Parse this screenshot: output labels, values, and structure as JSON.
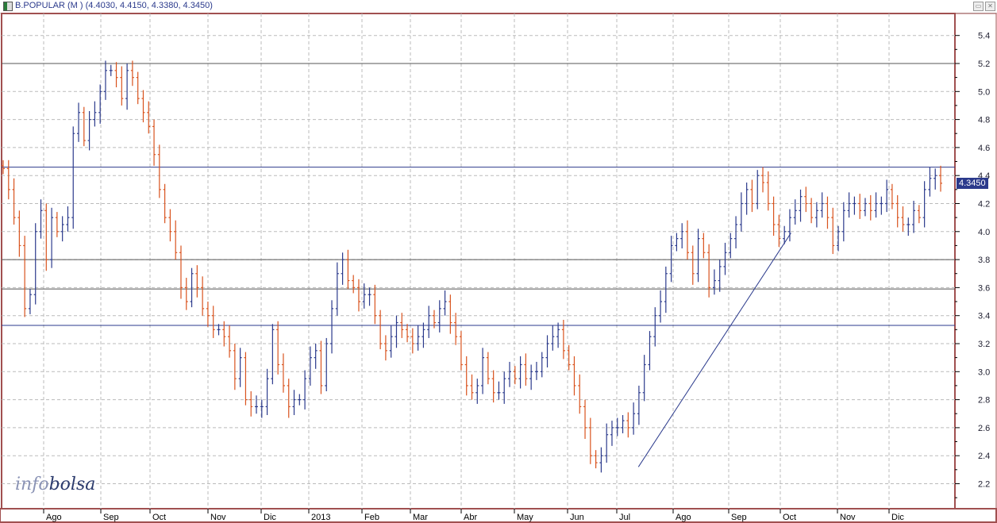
{
  "window": {
    "title": "B.POPULAR (M ) (4.4030, 4.4150, 4.3380, 4.3450)",
    "icon": "chart-window-icon",
    "buttons": [
      "maximize-icon",
      "close-icon"
    ]
  },
  "logo": {
    "part1": "info",
    "part2": "bolsa"
  },
  "last_price_tag": "4.3450",
  "colors": {
    "up": "#2b3a8c",
    "down": "#d9531e",
    "border": "#a05050",
    "grid": "#bbbbbb"
  },
  "chart_data": {
    "type": "ohlc",
    "ylim": [
      2.0,
      5.5
    ],
    "yticks": [
      "5.4",
      "5.2",
      "5.0",
      "4.8",
      "4.6",
      "4.4",
      "4.2",
      "4.0",
      "3.8",
      "3.6",
      "3.4",
      "3.2",
      "3.0",
      "2.8",
      "2.6",
      "2.4",
      "2.2"
    ],
    "xticks": [
      "Ago",
      "Sep",
      "Oct",
      "Nov",
      "Dic",
      "2013",
      "Feb",
      "Mar",
      "Abr",
      "May",
      "Jun",
      "Jul",
      "Ago",
      "Sep",
      "Oct",
      "Nov",
      "Dic"
    ],
    "grid": true,
    "horizontal_lines": [
      {
        "value": 5.2,
        "color": "#555555"
      },
      {
        "value": 4.46,
        "color": "#2b3a8c"
      },
      {
        "value": 3.8,
        "color": "#555555"
      },
      {
        "value": 3.59,
        "color": "#555555"
      },
      {
        "value": 3.33,
        "color": "#2b3a8c"
      }
    ],
    "trendline": {
      "from": {
        "bar_fraction": 0.668,
        "value": 2.32
      },
      "to": {
        "bar_fraction": 0.828,
        "value": 3.99
      },
      "color": "#2b3a8c"
    },
    "closes": [
      4.45,
      4.3,
      4.1,
      3.9,
      3.45,
      3.55,
      4.0,
      4.15,
      3.8,
      4.1,
      4.0,
      4.05,
      4.1,
      4.7,
      4.85,
      4.65,
      4.8,
      4.85,
      5.0,
      5.15,
      5.15,
      5.1,
      4.95,
      5.15,
      5.1,
      4.95,
      4.85,
      4.75,
      4.55,
      4.3,
      4.1,
      4.0,
      3.85,
      3.6,
      3.5,
      3.7,
      3.6,
      3.45,
      3.4,
      3.3,
      3.3,
      3.25,
      3.15,
      2.95,
      3.1,
      2.8,
      2.75,
      2.75,
      2.75,
      2.95,
      3.3,
      3.05,
      2.9,
      2.75,
      2.8,
      2.8,
      2.95,
      3.1,
      3.15,
      2.9,
      3.2,
      3.45,
      3.7,
      3.8,
      3.65,
      3.6,
      3.5,
      3.55,
      3.55,
      3.4,
      3.2,
      3.15,
      3.25,
      3.35,
      3.3,
      3.25,
      3.2,
      3.25,
      3.3,
      3.4,
      3.35,
      3.45,
      3.5,
      3.35,
      3.25,
      3.05,
      2.9,
      2.85,
      2.9,
      3.1,
      2.95,
      2.85,
      2.85,
      2.95,
      3.0,
      2.95,
      3.05,
      2.95,
      3.0,
      3.0,
      3.1,
      3.2,
      3.25,
      3.3,
      3.15,
      3.05,
      2.9,
      2.75,
      2.6,
      2.4,
      2.35,
      2.4,
      2.55,
      2.6,
      2.6,
      2.65,
      2.6,
      2.7,
      2.85,
      3.05,
      3.25,
      3.4,
      3.5,
      3.7,
      3.9,
      3.95,
      4.0,
      3.85,
      3.7,
      3.95,
      3.85,
      3.6,
      3.65,
      3.75,
      3.85,
      3.95,
      4.05,
      4.2,
      4.3,
      4.2,
      4.4,
      4.35,
      4.2,
      4.05,
      3.95,
      4.0,
      4.1,
      4.15,
      4.25,
      4.2,
      4.1,
      4.15,
      4.2,
      4.1,
      3.9,
      4.0,
      4.15,
      4.2,
      4.2,
      4.15,
      4.2,
      4.15,
      4.2,
      4.2,
      4.3,
      4.2,
      4.1,
      4.05,
      4.05,
      4.15,
      4.1,
      4.3,
      4.38,
      4.4,
      4.345
    ]
  }
}
